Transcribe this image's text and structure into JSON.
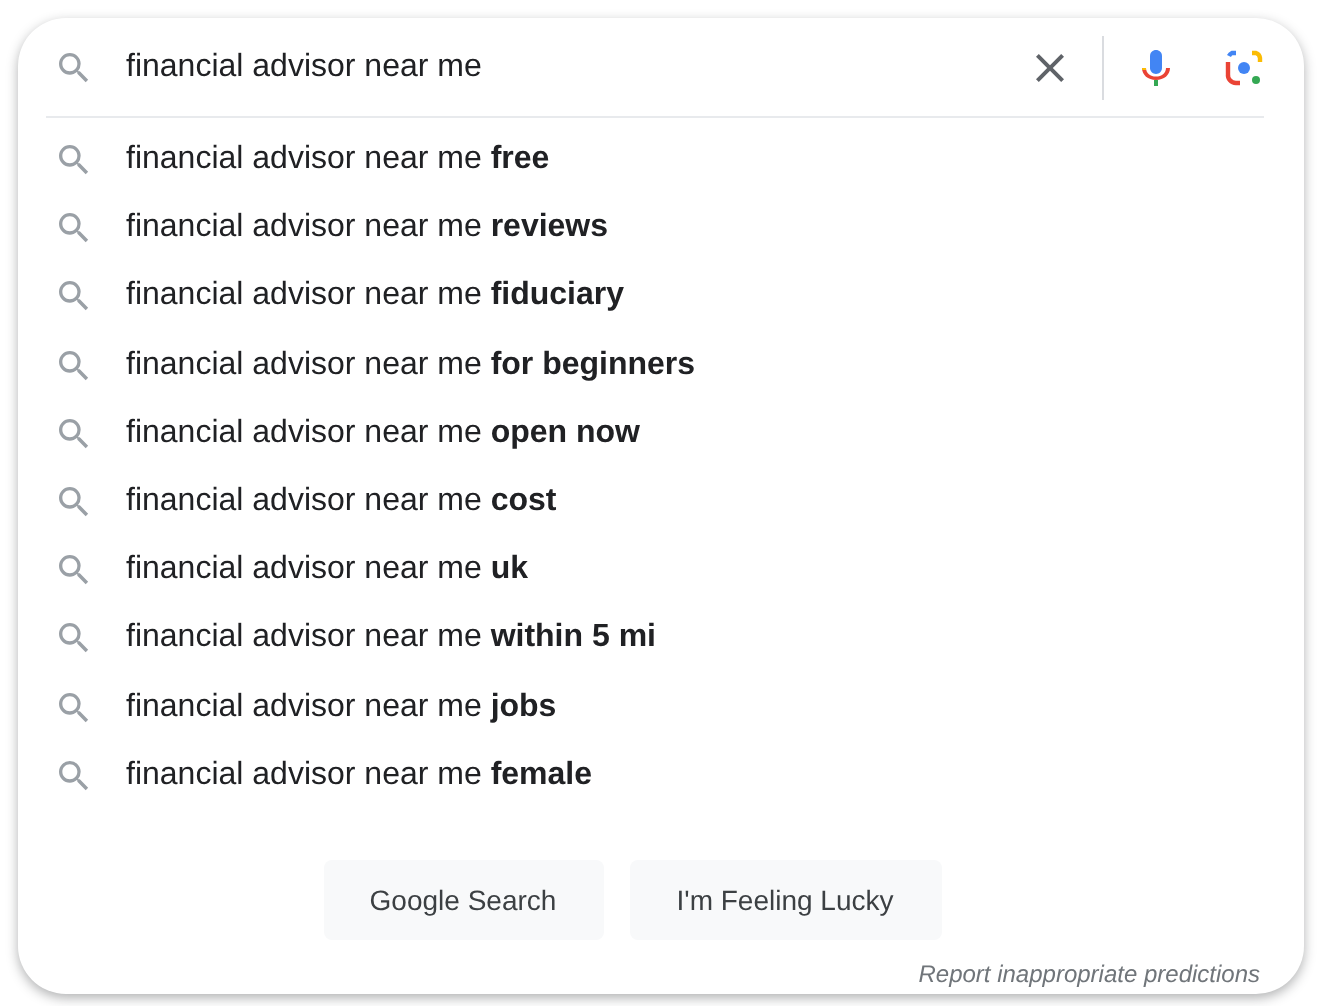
{
  "search": {
    "value": "financial advisor near me"
  },
  "suggestions": [
    "financial advisor near me **free**",
    "financial advisor near me **reviews**",
    "financial advisor near me **fiduciary**",
    "financial advisor near me **for beginners**",
    "financial advisor near me **open now**",
    "financial advisor near me **cost**",
    "financial advisor near me **uk**",
    "financial advisor near me **within 5 mi**",
    "financial advisor near me **jobs**",
    "financial advisor near me **female**"
  ],
  "buttons": [
    "Google Search",
    "I'm Feeling Lucky"
  ],
  "report_link": "Report inappropriate predictions"
}
